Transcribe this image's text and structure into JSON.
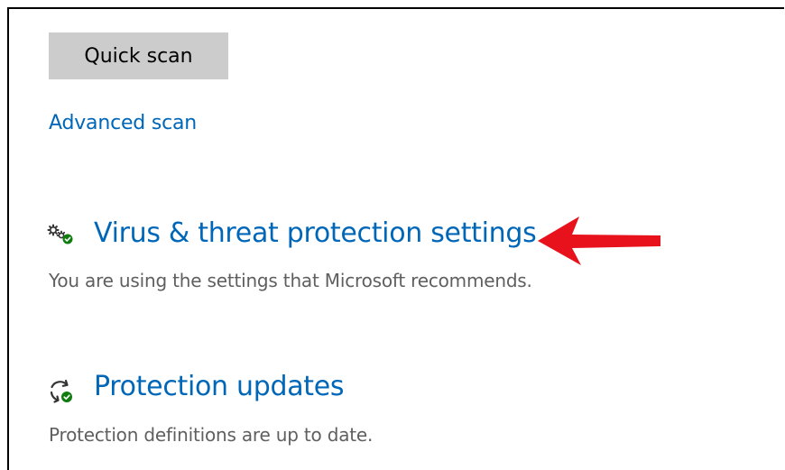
{
  "scan": {
    "quick_scan_label": "Quick scan",
    "advanced_scan_label": "Advanced scan"
  },
  "virus_threat": {
    "title": "Virus & threat protection settings",
    "description": "You are using the settings that Microsoft recommends.",
    "icon": "gears-check-icon"
  },
  "protection_updates": {
    "title": "Protection updates",
    "description": "Protection definitions are up to date.",
    "icon": "refresh-check-icon"
  },
  "colors": {
    "link": "#0067b8",
    "button_bg": "#cccccc",
    "description": "#5f5f5f",
    "check_green": "#107c10",
    "annotation_red": "#e8121c"
  }
}
